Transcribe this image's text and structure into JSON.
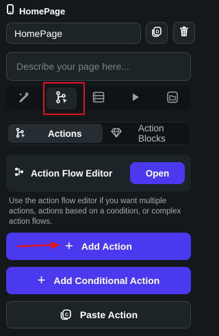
{
  "header": {
    "title": "HomePage",
    "icon": "phone-icon"
  },
  "page_name": {
    "value": "HomePage"
  },
  "description": {
    "placeholder": "Describe your page here..."
  },
  "toolbar": {
    "tools": [
      "magic-wand-icon",
      "action-flow-icon",
      "database-icon",
      "play-icon",
      "folder-icon"
    ],
    "active": "action-flow-icon"
  },
  "tabs": {
    "actions": "Actions",
    "action_blocks": "Action Blocks"
  },
  "flow_editor": {
    "label": "Action Flow Editor",
    "button": "Open"
  },
  "help_text": "Use the action flow editor if you want multiple actions, actions based on a condition, or complex action flows.",
  "buttons": {
    "add_action": "Add Action",
    "add_conditional": "Add Conditional Action",
    "paste": "Paste Action"
  },
  "colors": {
    "accent": "#4b39ef",
    "background": "#14181b",
    "highlight": "#e0151b"
  }
}
